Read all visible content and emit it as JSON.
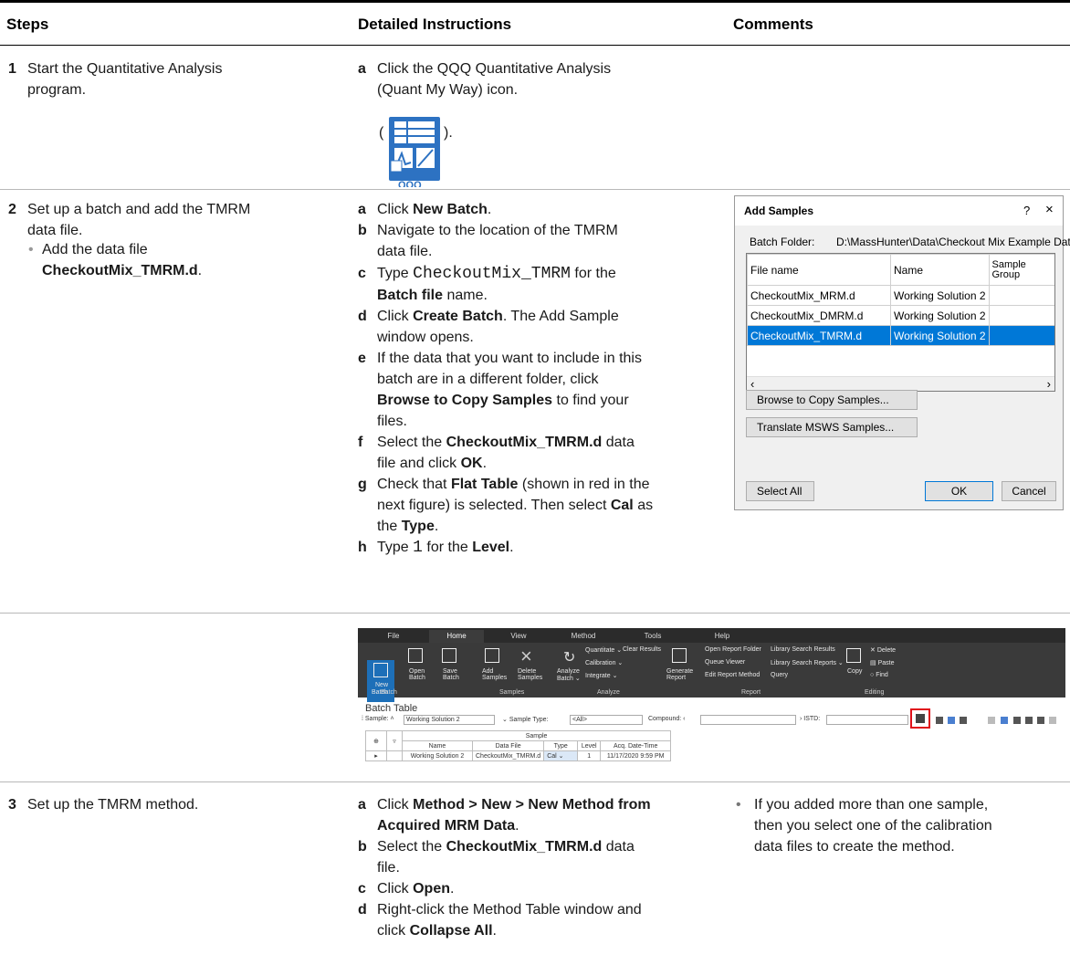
{
  "header": {
    "steps": "Steps",
    "instructions": "Detailed Instructions",
    "comments": "Comments"
  },
  "step1": {
    "num": "1",
    "title": [
      "Start the Quantitative Analysis",
      "program."
    ],
    "a": {
      "letter": "a",
      "lines": [
        "Click the QQQ Quantitative Analysis",
        "(Quant My Way) icon."
      ]
    },
    "icon_open": "(",
    "icon_close": ").",
    "icon_caption": "QQQ"
  },
  "step2": {
    "num": "2",
    "title": [
      "Set up a batch and add the TMRM",
      "data file."
    ],
    "bullet_text": "Add the data file",
    "bullet_file": "CheckoutMix_TMRM.d",
    "bullet_end": ".",
    "a": {
      "pre": "Click ",
      "b": "New Batch",
      "post": "."
    },
    "b": {
      "l1": "Navigate to the location of the TMRM",
      "l2": "data file."
    },
    "c": {
      "pre": "Type ",
      "code": "CheckoutMix_TMRM",
      "post": " for the",
      "b": "Batch file",
      "post2": " name."
    },
    "d": {
      "pre": "Click ",
      "b": "Create Batch",
      "post": ". The Add Sample",
      "l2": "window opens."
    },
    "e": {
      "l1": "If the data that you want to include in this",
      "l2": "batch are in a different folder, click",
      "b": "Browse to Copy Samples",
      "post": " to find your",
      "l4": "files."
    },
    "f": {
      "pre": "Select the ",
      "b": "CheckoutMix_TMRM.d",
      "post": " data",
      "l2pre": "file and click ",
      "l2b": "OK",
      "l2post": "."
    },
    "g": {
      "pre": "Check that ",
      "b": "Flat Table",
      "post": " (shown in red in the",
      "l2pre": "next figure) is selected. Then select ",
      "l2b": "Cal",
      "l2post": " as",
      "l3pre": "the ",
      "l3b": "Type",
      "l3post": "."
    },
    "h": {
      "pre": "Type ",
      "code": "1",
      "mid": " for the ",
      "b": "Level",
      "post": "."
    }
  },
  "dialog": {
    "title": "Add Samples",
    "help": "?",
    "close": "×",
    "folder_label": "Batch Folder:",
    "folder_path": "D:\\MassHunter\\Data\\Checkout Mix Example Data\\",
    "columns": [
      "File name",
      "Name",
      "Sample Group"
    ],
    "rows": [
      [
        "CheckoutMix_MRM.d",
        "Working Solution 2",
        ""
      ],
      [
        "CheckoutMix_DMRM.d",
        "Working Solution 2",
        ""
      ],
      [
        "CheckoutMix_TMRM.d",
        "Working Solution 2",
        ""
      ]
    ],
    "browse_button": "Browse to Copy Samples...",
    "translate_button": "Translate MSWS Samples...",
    "select_all": "Select All",
    "ok": "OK",
    "cancel": "Cancel"
  },
  "ribbon": {
    "tabs": [
      "File",
      "Home",
      "View",
      "Method",
      "Tools",
      "Help"
    ],
    "buttons": {
      "new_batch": [
        "New",
        "Batch"
      ],
      "open_batch": [
        "Open",
        "Batch"
      ],
      "save_batch": [
        "Save",
        "Batch"
      ],
      "add_samples": [
        "Add",
        "Samples"
      ],
      "delete_samples": [
        "Delete",
        "Samples"
      ],
      "analyze_batch": [
        "Analyze",
        "Batch ⌄"
      ],
      "quantitate": "Quantitate ⌄",
      "clear_results": "Clear Results",
      "calibration": "Calibration ⌄",
      "integrate": "Integrate ⌄",
      "generate_report": [
        "Generate",
        "Report"
      ],
      "open_report_folder": "Open Report Folder",
      "queue_viewer": "Queue Viewer",
      "edit_report_method": "Edit Report Method",
      "library_search_results": "Library Search Results",
      "library_search_reports": "Library Search Reports ⌄",
      "query": "Query",
      "copy": "Copy",
      "delete": "Delete",
      "paste": "Paste",
      "find": "Find"
    },
    "groups": [
      "Batch",
      "Samples",
      "Analyze",
      "Report",
      "Editing"
    ]
  },
  "batch_table": {
    "title": "Batch Table",
    "sample_label": "Sample:",
    "sample_value": "Working Solution 2",
    "sample_type_label": "Sample Type:",
    "sample_type_value": "<All>",
    "compound_label": "Compound:",
    "istd_label": "ISTD:",
    "group_header": "Sample",
    "columns": [
      "Name",
      "Data File",
      "Type",
      "Level",
      "Acq. Date-Time"
    ],
    "row": [
      "Working Solution 2",
      "CheckoutMix_TMRM.d",
      "Cal",
      "1",
      "11/17/2020 9:59 PM"
    ]
  },
  "step3": {
    "num": "3",
    "title": "Set up the TMRM method.",
    "a": {
      "b": "Click ",
      "b1": "Method > New > New Method from",
      "b2": "Acquired MRM Data",
      "post": "."
    },
    "b": {
      "pre": "Select the ",
      "b": "CheckoutMix_TMRM.d",
      "post": " data",
      "l2": "file."
    },
    "c": {
      "pre": "Click ",
      "b": "Open",
      "post": "."
    },
    "d": {
      "l1": "Right-click the Method Table window and",
      "l2pre": "click ",
      "l2b": "Collapse All",
      "l2post": "."
    },
    "comment": [
      "If you added more than one sample,",
      "then you select one of the calibration",
      "data files to create the method."
    ]
  }
}
